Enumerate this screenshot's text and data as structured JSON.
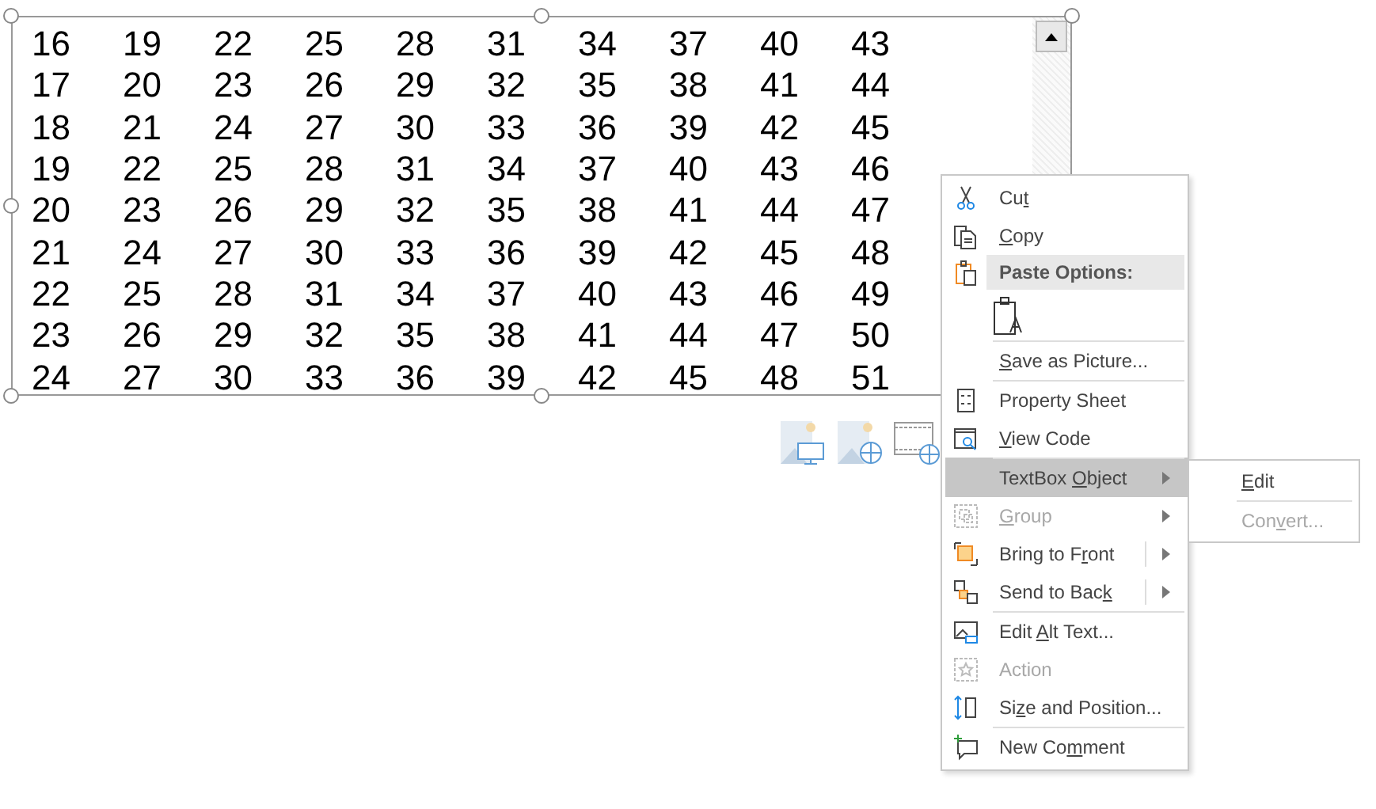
{
  "text_box": {
    "rows": [
      [
        "16",
        "19",
        "22",
        "25",
        "28",
        "31",
        "34",
        "37",
        "40",
        "43"
      ],
      [
        "17",
        "20",
        "23",
        "26",
        "29",
        "32",
        "35",
        "38",
        "41",
        "44"
      ],
      [
        "18",
        "21",
        "24",
        "27",
        "30",
        "33",
        "36",
        "39",
        "42",
        "45"
      ],
      [
        "19",
        "22",
        "25",
        "28",
        "31",
        "34",
        "37",
        "40",
        "43",
        "46"
      ],
      [
        "20",
        "23",
        "26",
        "29",
        "32",
        "35",
        "38",
        "41",
        "44",
        "47"
      ],
      [
        "21",
        "24",
        "27",
        "30",
        "33",
        "36",
        "39",
        "42",
        "45",
        "48"
      ],
      [
        "22",
        "25",
        "28",
        "31",
        "34",
        "37",
        "40",
        "43",
        "46",
        "49"
      ],
      [
        "23",
        "26",
        "29",
        "32",
        "35",
        "38",
        "41",
        "44",
        "47",
        "50"
      ],
      [
        "24",
        "27",
        "30",
        "33",
        "36",
        "39",
        "42",
        "45",
        "48",
        "51"
      ]
    ]
  },
  "context_menu": {
    "items": [
      {
        "kind": "item",
        "pre": "Cu",
        "key": "t",
        "disabled": false,
        "selected": false,
        "submenu": false,
        "split": false,
        "divider": false
      },
      {
        "kind": "item",
        "key": "C",
        "post": "opy",
        "disabled": false,
        "selected": false,
        "submenu": false,
        "split": false,
        "divider": false
      },
      {
        "kind": "header",
        "label": "Paste Options:"
      },
      {
        "kind": "paste-option"
      },
      {
        "kind": "item",
        "key": "S",
        "post": "ave as Picture...",
        "disabled": false,
        "selected": false,
        "submenu": false,
        "split": false,
        "divider": true
      },
      {
        "kind": "item",
        "pre": "Property Sheet",
        "disabled": false,
        "selected": false,
        "submenu": false,
        "split": false,
        "divider": true
      },
      {
        "kind": "item",
        "key": "V",
        "post": "iew Code",
        "disabled": false,
        "selected": false,
        "submenu": false,
        "split": false,
        "divider": false
      },
      {
        "kind": "item",
        "pre": "TextBox ",
        "key": "O",
        "post": "bject",
        "disabled": false,
        "selected": true,
        "submenu": true,
        "split": false,
        "divider": true
      },
      {
        "kind": "item",
        "key": "G",
        "post": "roup",
        "disabled": true,
        "selected": false,
        "submenu": true,
        "split": false,
        "divider": false
      },
      {
        "kind": "item",
        "pre": "Bring to F",
        "key": "r",
        "post": "ont",
        "disabled": false,
        "selected": false,
        "submenu": true,
        "split": true,
        "divider": false
      },
      {
        "kind": "item",
        "pre": "Send to Bac",
        "key": "k",
        "disabled": false,
        "selected": false,
        "submenu": true,
        "split": true,
        "divider": false
      },
      {
        "kind": "item",
        "pre": "Edit ",
        "key": "A",
        "post": "lt Text...",
        "disabled": false,
        "selected": false,
        "submenu": false,
        "split": false,
        "divider": true
      },
      {
        "kind": "item",
        "pre": "Action",
        "disabled": true,
        "selected": false,
        "submenu": false,
        "split": false,
        "divider": false
      },
      {
        "kind": "item",
        "pre": "Si",
        "key": "z",
        "post": "e and Position...",
        "disabled": false,
        "selected": false,
        "submenu": false,
        "split": false,
        "divider": false
      },
      {
        "kind": "item",
        "pre": "New Co",
        "key": "m",
        "post": "ment",
        "disabled": false,
        "selected": false,
        "submenu": false,
        "split": false,
        "divider": true
      }
    ]
  },
  "submenu": {
    "items": [
      {
        "key": "E",
        "post": "dit",
        "disabled": false,
        "divider": false
      },
      {
        "pre": "Con",
        "key": "v",
        "post": "ert...",
        "disabled": true,
        "divider": true
      }
    ]
  }
}
